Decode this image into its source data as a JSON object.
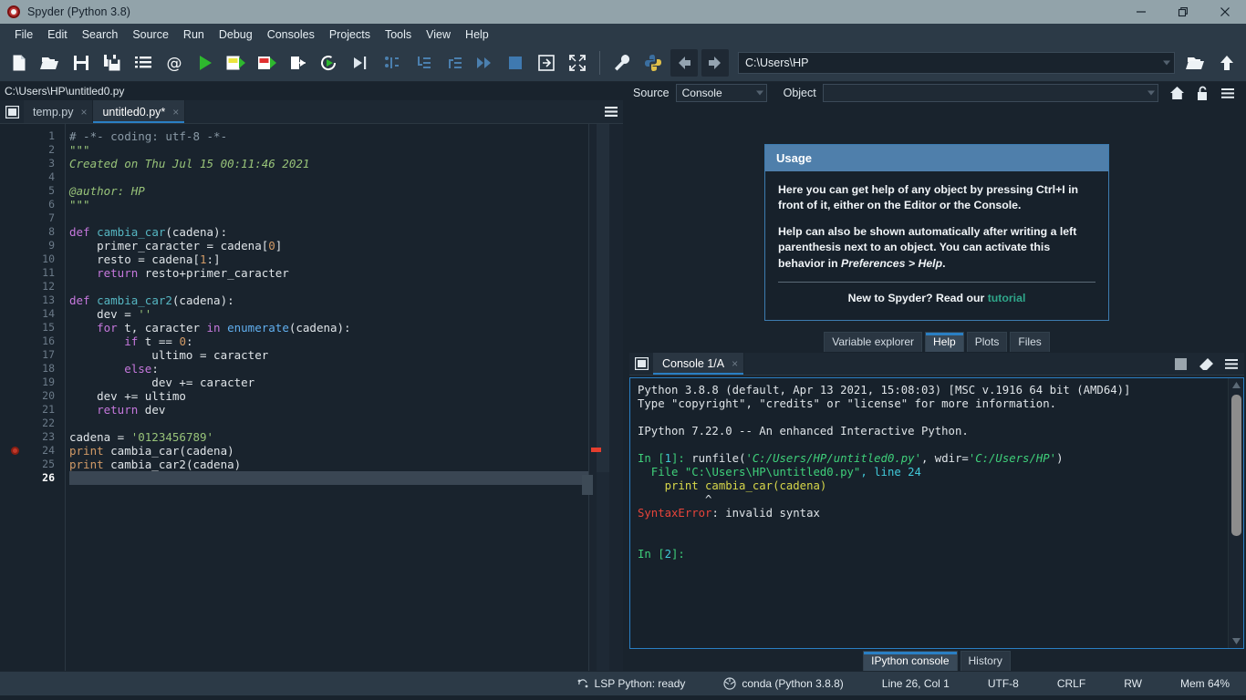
{
  "titlebar": {
    "title": "Spyder (Python 3.8)",
    "icon": "spyder-logo-icon",
    "buttons": [
      {
        "name": "minimize-button",
        "glyph": "minimize"
      },
      {
        "name": "maximize-button",
        "glyph": "maximize"
      },
      {
        "name": "close-button",
        "glyph": "close"
      }
    ]
  },
  "menubar": {
    "items": [
      "File",
      "Edit",
      "Search",
      "Source",
      "Run",
      "Debug",
      "Consoles",
      "Projects",
      "Tools",
      "View",
      "Help"
    ]
  },
  "toolbar": {
    "icons": [
      "new-file-icon",
      "open-file-icon",
      "save-file-icon",
      "save-all-icon",
      "file-switcher-icon",
      "find-symbol-icon",
      "run-file-icon",
      "run-cell-icon",
      "run-cell-advance-icon",
      "run-selection-icon",
      "re-run-cell-icon",
      "debug-file-icon",
      "step-over-icon",
      "step-into-icon",
      "step-return-icon",
      "continue-icon",
      "stop-debug-icon",
      "maximize-pane-icon",
      "fullscreen-icon"
    ],
    "preferences_icon": "wrench-icon",
    "pythonpath_icon": "python-logo-icon",
    "back_icon": "arrow-left-icon",
    "forward_icon": "arrow-right-icon",
    "path_value": "C:\\Users\\HP",
    "browse_icon": "open-folder-icon",
    "parent_icon": "arrow-up-icon"
  },
  "editor": {
    "file_path": "C:\\Users\\HP\\untitled0.py",
    "browse_tabs_icon": "browse-tabs-icon",
    "options_icon": "hamburger-menu-icon",
    "tabs": [
      {
        "label": "temp.py",
        "active": false,
        "close": "×"
      },
      {
        "label": "untitled0.py*",
        "active": true,
        "close": "×"
      }
    ],
    "current_line": 26,
    "breakpoint_line": 24,
    "lines": [
      {
        "n": 1,
        "tokens": [
          {
            "t": "# -*- coding: utf-8 -*-",
            "c": "cm"
          }
        ]
      },
      {
        "n": 2,
        "tokens": [
          {
            "t": "\"\"\"",
            "c": "ds"
          }
        ]
      },
      {
        "n": 3,
        "tokens": [
          {
            "t": "Created on Thu Jul 15 00:11:46 2021",
            "c": "ds"
          }
        ]
      },
      {
        "n": 4,
        "tokens": [
          {
            "t": "",
            "c": "ds"
          }
        ]
      },
      {
        "n": 5,
        "tokens": [
          {
            "t": "@author: HP",
            "c": "ds"
          }
        ]
      },
      {
        "n": 6,
        "tokens": [
          {
            "t": "\"\"\"",
            "c": "ds"
          }
        ]
      },
      {
        "n": 7,
        "tokens": [
          {
            "t": "",
            "c": ""
          }
        ]
      },
      {
        "n": 8,
        "tokens": [
          {
            "t": "def ",
            "c": "k"
          },
          {
            "t": "cambia_car",
            "c": "fn"
          },
          {
            "t": "(cadena):",
            "c": ""
          }
        ]
      },
      {
        "n": 9,
        "tokens": [
          {
            "t": "    primer_caracter = cadena[",
            "c": ""
          },
          {
            "t": "0",
            "c": "num"
          },
          {
            "t": "]",
            "c": ""
          }
        ]
      },
      {
        "n": 10,
        "tokens": [
          {
            "t": "    resto = cadena[",
            "c": ""
          },
          {
            "t": "1",
            "c": "num"
          },
          {
            "t": ":]",
            "c": ""
          }
        ]
      },
      {
        "n": 11,
        "tokens": [
          {
            "t": "    return ",
            "c": "k"
          },
          {
            "t": "resto+primer_caracter",
            "c": ""
          }
        ]
      },
      {
        "n": 12,
        "tokens": [
          {
            "t": "",
            "c": ""
          }
        ]
      },
      {
        "n": 13,
        "tokens": [
          {
            "t": "def ",
            "c": "k"
          },
          {
            "t": "cambia_car2",
            "c": "fn"
          },
          {
            "t": "(cadena):",
            "c": ""
          }
        ]
      },
      {
        "n": 14,
        "tokens": [
          {
            "t": "    dev = ",
            "c": ""
          },
          {
            "t": "''",
            "c": "str"
          }
        ]
      },
      {
        "n": 15,
        "tokens": [
          {
            "t": "    for ",
            "c": "k"
          },
          {
            "t": "t, caracter ",
            "c": ""
          },
          {
            "t": "in ",
            "c": "k"
          },
          {
            "t": "enumerate",
            "c": "bi"
          },
          {
            "t": "(cadena):",
            "c": ""
          }
        ]
      },
      {
        "n": 16,
        "tokens": [
          {
            "t": "        if ",
            "c": "k"
          },
          {
            "t": "t == ",
            "c": ""
          },
          {
            "t": "0",
            "c": "num"
          },
          {
            "t": ":",
            "c": ""
          }
        ]
      },
      {
        "n": 17,
        "tokens": [
          {
            "t": "            ultimo = caracter",
            "c": ""
          }
        ]
      },
      {
        "n": 18,
        "tokens": [
          {
            "t": "        else",
            "c": "k"
          },
          {
            "t": ":",
            "c": ""
          }
        ]
      },
      {
        "n": 19,
        "tokens": [
          {
            "t": "            dev += caracter",
            "c": ""
          }
        ]
      },
      {
        "n": 20,
        "tokens": [
          {
            "t": "    dev += ultimo",
            "c": ""
          }
        ]
      },
      {
        "n": 21,
        "tokens": [
          {
            "t": "    return ",
            "c": "k"
          },
          {
            "t": "dev",
            "c": ""
          }
        ]
      },
      {
        "n": 22,
        "tokens": [
          {
            "t": "",
            "c": ""
          }
        ]
      },
      {
        "n": 23,
        "tokens": [
          {
            "t": "cadena = ",
            "c": ""
          },
          {
            "t": "'0123456789'",
            "c": "str"
          }
        ]
      },
      {
        "n": 24,
        "tokens": [
          {
            "t": "print ",
            "c": "pr"
          },
          {
            "t": "cambia_car(cadena)",
            "c": ""
          }
        ]
      },
      {
        "n": 25,
        "tokens": [
          {
            "t": "print ",
            "c": "pr"
          },
          {
            "t": "cambia_car2(cadena)",
            "c": ""
          }
        ]
      },
      {
        "n": 26,
        "tokens": [
          {
            "t": "",
            "c": ""
          }
        ]
      }
    ]
  },
  "help": {
    "source_label": "Source",
    "source_value": "Console",
    "object_label": "Object",
    "object_value": "",
    "home_icon": "home-icon",
    "lock_icon": "unlocked-padlock-icon",
    "options_icon": "hamburger-menu-icon",
    "card": {
      "heading": "Usage",
      "p1_a": "Here you can get help of any object by pressing ",
      "p1_shortcut": "Ctrl+I",
      "p1_b": " in front of it, either on the Editor or the Console.",
      "p2_a": "Help can also be shown automatically after writing a left parenthesis next to an object. You can activate this behavior in ",
      "p2_italic": "Preferences > Help",
      "p2_b": ".",
      "footer_text": "New to Spyder? Read our ",
      "footer_link": "tutorial"
    },
    "tabs": [
      {
        "label": "Variable explorer",
        "active": false
      },
      {
        "label": "Help",
        "active": true
      },
      {
        "label": "Plots",
        "active": false
      },
      {
        "label": "Files",
        "active": false
      }
    ]
  },
  "console": {
    "browse_tabs_icon": "browse-tabs-icon",
    "stop_icon": "stop-square-icon",
    "clear_icon": "eraser-icon",
    "options_icon": "hamburger-menu-icon",
    "tabs": [
      {
        "label": "Console 1/A",
        "active": true,
        "close": "×"
      }
    ],
    "lines": [
      [
        {
          "t": "Python 3.8.8 (default, Apr 13 2021, 15:08:03) [MSC v.1916 64 bit (AMD64)]",
          "c": ""
        }
      ],
      [
        {
          "t": "Type \"copyright\", \"credits\" or \"license\" for more information.",
          "c": ""
        }
      ],
      [
        {
          "t": "",
          "c": ""
        }
      ],
      [
        {
          "t": "IPython 7.22.0 -- An enhanced Interactive Python.",
          "c": ""
        }
      ],
      [
        {
          "t": "",
          "c": ""
        }
      ],
      [
        {
          "t": "In [",
          "c": "cg"
        },
        {
          "t": "1",
          "c": "cc"
        },
        {
          "t": "]: ",
          "c": "cg"
        },
        {
          "t": "runfile(",
          "c": ""
        },
        {
          "t": "'C:/Users/HP/untitled0.py'",
          "c": "cgi"
        },
        {
          "t": ", wdir=",
          "c": ""
        },
        {
          "t": "'C:/Users/HP'",
          "c": "cgi"
        },
        {
          "t": ")",
          "c": ""
        }
      ],
      [
        {
          "t": "  File ",
          "c": "cg"
        },
        {
          "t": "\"C:\\Users\\HP\\untitled0.py\"",
          "c": "cg"
        },
        {
          "t": ", line ",
          "c": "cc"
        },
        {
          "t": "24",
          "c": "cc"
        }
      ],
      [
        {
          "t": "    print cambia_car(cadena)",
          "c": "cy"
        }
      ],
      [
        {
          "t": "          ^",
          "c": ""
        }
      ],
      [
        {
          "t": "SyntaxError",
          "c": "cr"
        },
        {
          "t": ": invalid syntax",
          "c": ""
        }
      ],
      [
        {
          "t": "",
          "c": ""
        }
      ],
      [
        {
          "t": "",
          "c": ""
        }
      ],
      [
        {
          "t": "In [",
          "c": "cg"
        },
        {
          "t": "2",
          "c": "cc"
        },
        {
          "t": "]: ",
          "c": "cg"
        }
      ]
    ],
    "tabs_bottom": [
      {
        "label": "IPython console",
        "active": true
      },
      {
        "label": "History",
        "active": false
      }
    ]
  },
  "statusbar": {
    "lsp_icon": "lsp-status-icon",
    "lsp": "LSP Python: ready",
    "env_icon": "conda-icon",
    "env": "conda (Python 3.8.8)",
    "cursor": "Line 26, Col 1",
    "encoding": "UTF-8",
    "eol": "CRLF",
    "permissions": "RW",
    "memory": "Mem 64%"
  },
  "colors": {
    "accent": "#2a7fc4",
    "titlebar_bg": "#92a3aa",
    "chrome_bg": "#2c3a47",
    "editor_bg": "#19232d",
    "console_bg": "#17212b",
    "error_red": "#e8443a",
    "keyword_purple": "#c678dd",
    "function_cyan": "#56b6c2",
    "string_green": "#98c379",
    "number_orange": "#d19a66",
    "link_teal": "#2fa68a"
  }
}
